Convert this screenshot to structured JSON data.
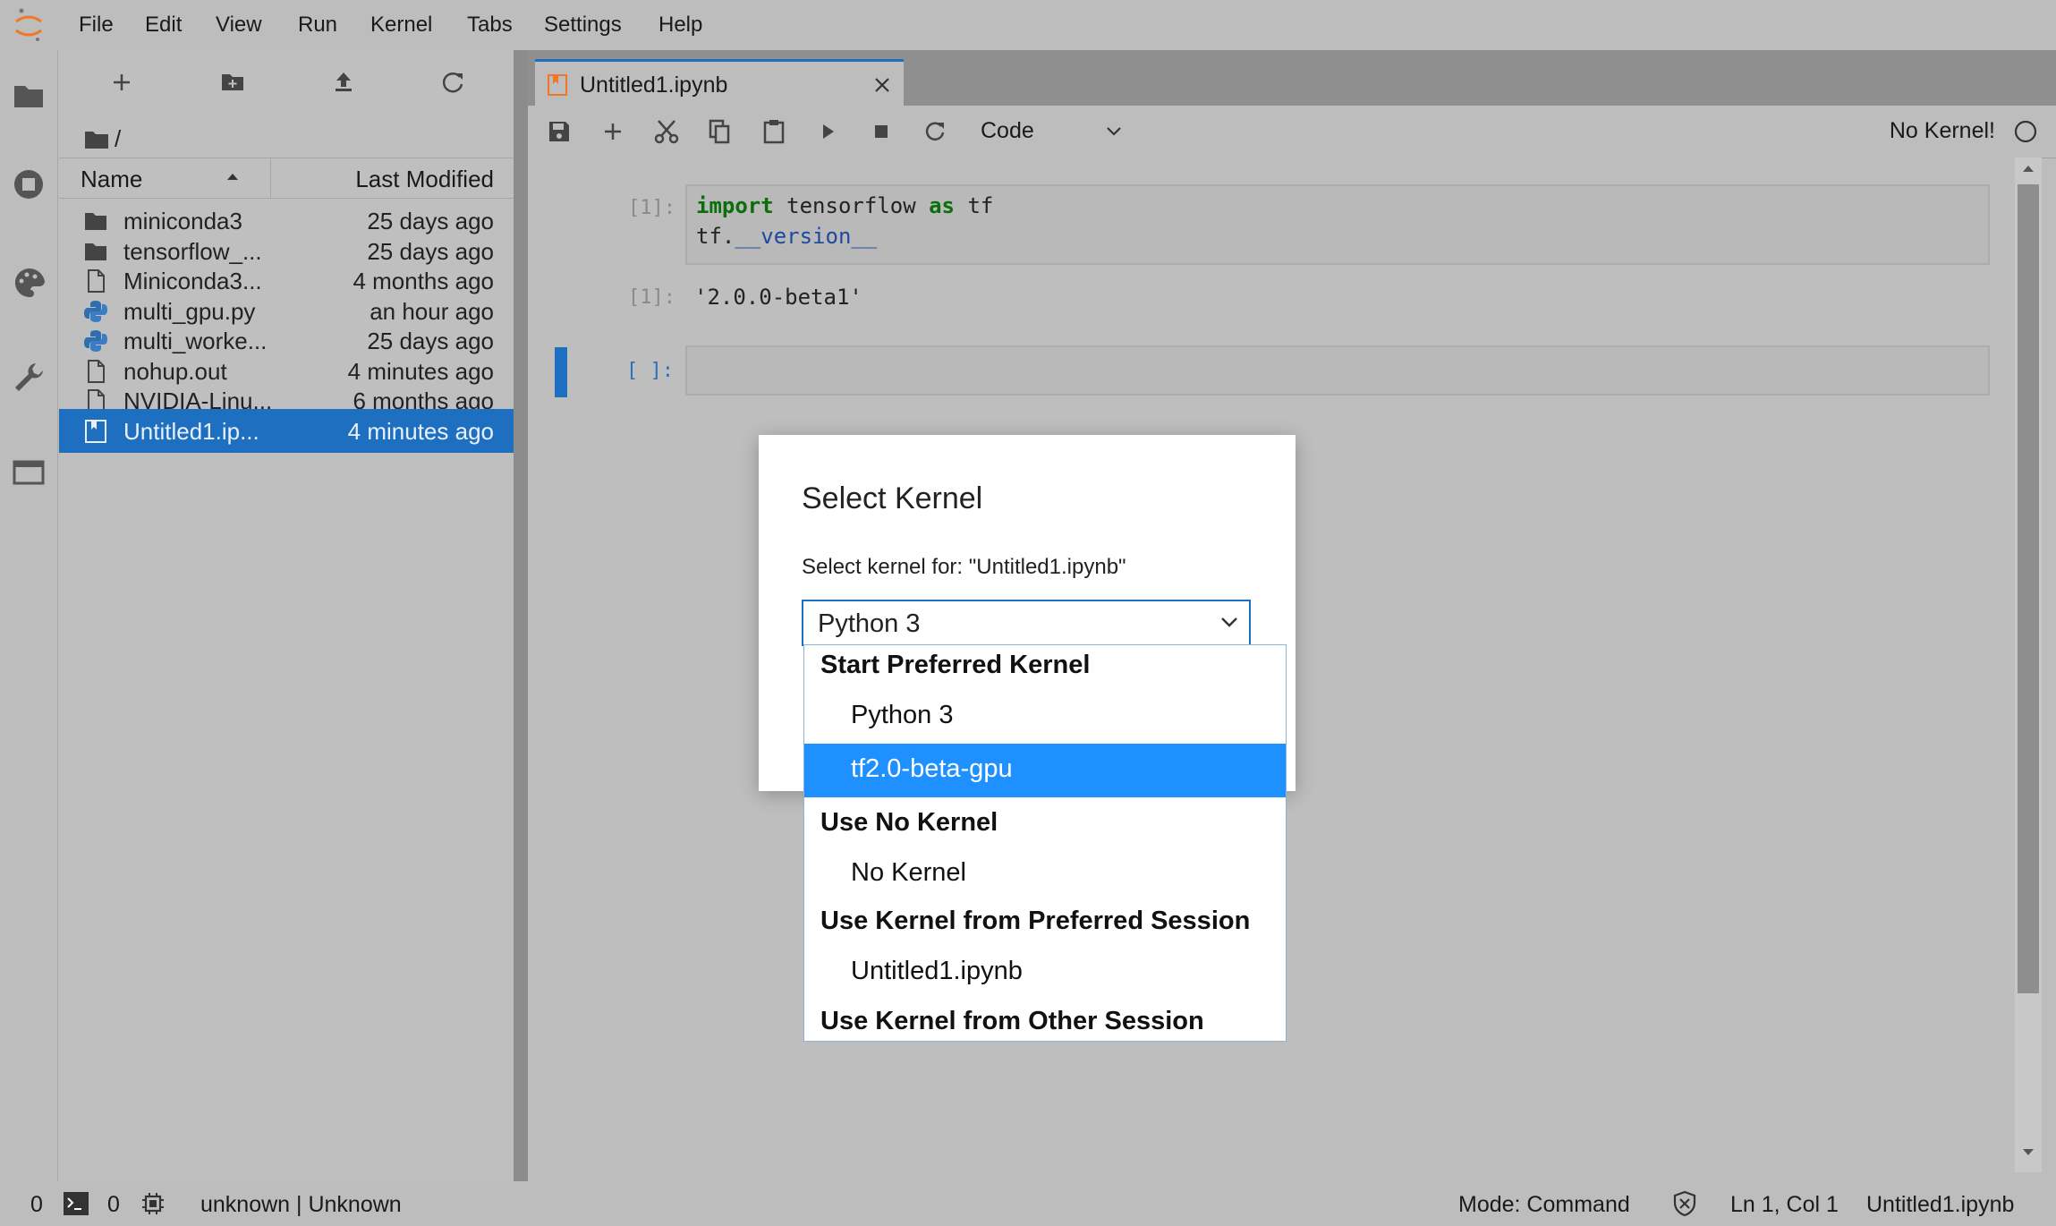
{
  "menubar": {
    "items": [
      "File",
      "Edit",
      "View",
      "Run",
      "Kernel",
      "Tabs",
      "Settings",
      "Help"
    ]
  },
  "file_browser": {
    "breadcrumb": "/",
    "columns": {
      "name": "Name",
      "modified": "Last Modified"
    },
    "files": [
      {
        "name": "miniconda3",
        "modified": "25 days ago",
        "icon": "folder-icon"
      },
      {
        "name": "tensorflow_...",
        "modified": "25 days ago",
        "icon": "folder-icon"
      },
      {
        "name": "Miniconda3...",
        "modified": "4 months ago",
        "icon": "file-icon"
      },
      {
        "name": "multi_gpu.py",
        "modified": "an hour ago",
        "icon": "python-icon"
      },
      {
        "name": "multi_worke...",
        "modified": "25 days ago",
        "icon": "python-icon"
      },
      {
        "name": "nohup.out",
        "modified": "4 minutes ago",
        "icon": "file-icon"
      },
      {
        "name": "NVIDIA-Linu...",
        "modified": "6 months ago",
        "icon": "file-icon"
      },
      {
        "name": "Untitled1.ip...",
        "modified": "4 minutes ago",
        "icon": "notebook-icon",
        "selected": true
      }
    ]
  },
  "notebook": {
    "tab_title": "Untitled1.ipynb",
    "cell_type": "Code",
    "kernel_status": "No Kernel!",
    "cells": {
      "in1_prompt": "[1]:",
      "in1_line1_kw1": "import",
      "in1_line1_mid": " tensorflow ",
      "in1_line1_kw2": "as",
      "in1_line1_end": " tf",
      "in1_line2_pre": "tf.",
      "in1_line2_attr": "__version__",
      "out1_prompt": "[1]:",
      "out1_text": "'2.0.0-beta1'",
      "in2_prompt": "[ ]:"
    }
  },
  "dialog": {
    "title": "Select Kernel",
    "label": "Select kernel for: \"Untitled1.ipynb\"",
    "selected_value": "Python 3",
    "groups": {
      "start_preferred": "Start Preferred Kernel",
      "use_no_kernel": "Use No Kernel",
      "preferred_session": "Use Kernel from Preferred Session",
      "other_session": "Use Kernel from Other Session"
    },
    "options": {
      "python3": "Python 3",
      "tf_gpu": "tf2.0-beta-gpu",
      "no_kernel": "No Kernel",
      "untitled": "Untitled1.ipynb"
    },
    "highlighted_option": "tf2.0-beta-gpu"
  },
  "statusbar": {
    "terminals_count": "0",
    "kernels_count": "0",
    "kernel_info": "unknown | Unknown",
    "mode": "Mode: Command",
    "position": "Ln 1, Col 1",
    "file": "Untitled1.ipynb"
  },
  "colors": {
    "accent": "#1f6fc0",
    "highlight": "#1e90ff",
    "keyword": "#0a6e0a",
    "logo": "#f37626"
  }
}
